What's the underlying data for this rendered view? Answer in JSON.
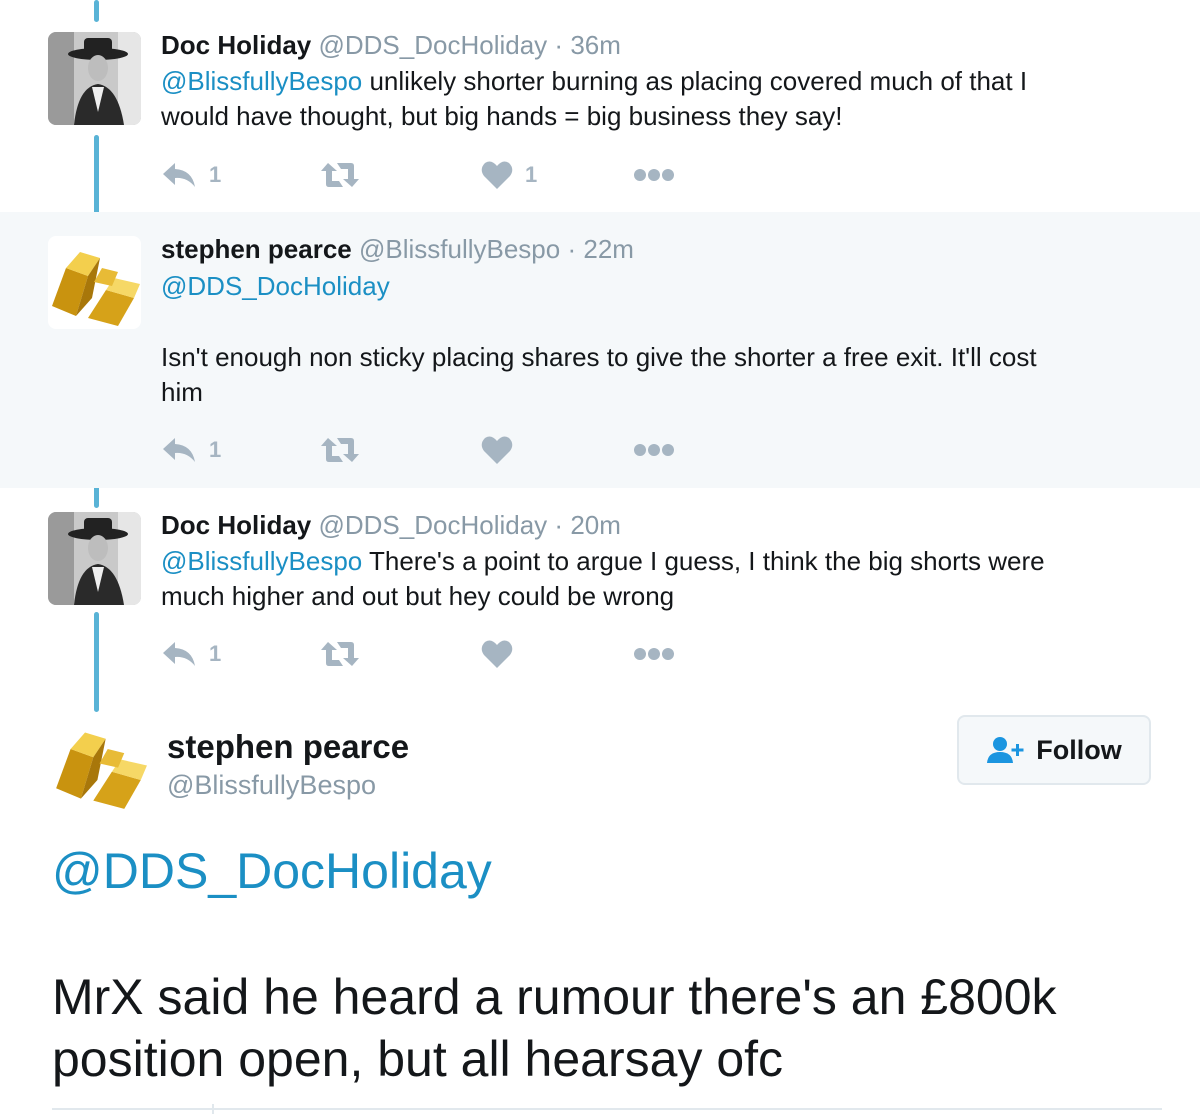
{
  "thread": [
    {
      "name": "Doc Holiday",
      "handle": "@DDS_DocHoliday",
      "separator": "·",
      "time": "36m",
      "mention": "@BlissfullyBespo",
      "text_line1": " unlikely shorter burning as placing covered much of that I",
      "text_line2": "would have thought, but big hands = big business they say!",
      "reply_count": "1",
      "like_count": "1",
      "avatar": "doc-holiday-avatar"
    },
    {
      "name": "stephen pearce",
      "handle": "@BlissfullyBespo",
      "separator": "·",
      "time": "22m",
      "mention": "@DDS_DocHoliday",
      "text_line1": "Isn't enough non sticky placing shares to give the shorter a free exit.  It'll cost",
      "text_line2": "him",
      "reply_count": "1",
      "like_count": "",
      "avatar": "gold-bars-avatar"
    },
    {
      "name": "Doc Holiday",
      "handle": "@DDS_DocHoliday",
      "separator": "·",
      "time": "20m",
      "mention": "@BlissfullyBespo",
      "text_line1": " There's a point to argue I guess, I think the big shorts were",
      "text_line2": "much higher and out but hey could be wrong",
      "reply_count": "1",
      "like_count": "",
      "avatar": "doc-holiday-avatar"
    }
  ],
  "expanded": {
    "name": "stephen pearce",
    "handle": "@BlissfullyBespo",
    "follow_label": "Follow",
    "mention": "@DDS_DocHoliday",
    "text_line1": "MrX said he heard a rumour there's an £800k",
    "text_line2": "position open, but all hearsay ofc"
  },
  "colors": {
    "link": "#1b8fc4",
    "thread_line": "#59b3d6",
    "muted": "#8899a6",
    "action_icon": "#a6b5c2",
    "highlight_bg": "#f5f8fa"
  },
  "icons": [
    "reply-icon",
    "retweet-icon",
    "heart-icon",
    "more-icon",
    "follow-user-icon"
  ]
}
